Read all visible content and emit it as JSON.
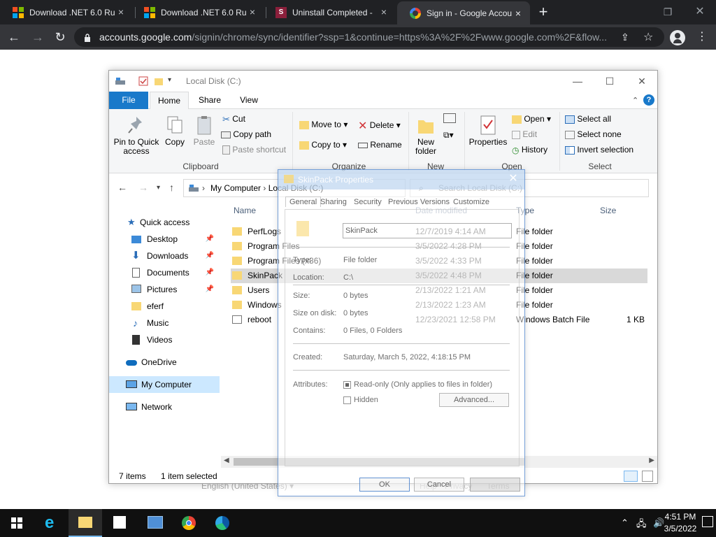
{
  "browser": {
    "tabs": [
      {
        "title": "Download .NET 6.0 Ru",
        "icon": "microsoft-icon"
      },
      {
        "title": "Download .NET 6.0 Ru",
        "icon": "microsoft-icon"
      },
      {
        "title": "Uninstall Completed -",
        "icon": "skinpack-icon"
      },
      {
        "title": "Sign in - Google Accou",
        "icon": "google-icon",
        "active": true
      }
    ],
    "url_host": "accounts.google.com",
    "url_path": "/signin/chrome/sync/identifier?ssp=1&continue=https%3A%2F%2Fwww.google.com%2F&flow..."
  },
  "explorer": {
    "title": "Local Disk (C:)",
    "ribbon_tabs": [
      "File",
      "Home",
      "Share",
      "View"
    ],
    "clipboard": {
      "pin_line1": "Pin to Quick",
      "pin_line2": "access",
      "copy": "Copy",
      "paste": "Paste",
      "cut": "Cut",
      "copy_path": "Copy path",
      "paste_shortcut": "Paste shortcut",
      "label": "Clipboard"
    },
    "organize": {
      "move_to": "Move to",
      "copy_to": "Copy to",
      "delete": "Delete",
      "rename": "Rename",
      "label": "Organize"
    },
    "new": {
      "line1": "New",
      "line2": "folder",
      "label": "New"
    },
    "open": {
      "properties": "Properties",
      "open": "Open",
      "edit": "Edit",
      "history": "History",
      "label": "Open"
    },
    "select": {
      "select_all": "Select all",
      "select_none": "Select none",
      "invert": "Invert selection",
      "label": "Select"
    },
    "address": {
      "root": "My Computer",
      "current": "Local Disk (C:)"
    },
    "search_placeholder": "Search Local Disk (C:)",
    "nav": {
      "quick_access": "Quick access",
      "desktop": "Desktop",
      "downloads": "Downloads",
      "documents": "Documents",
      "pictures": "Pictures",
      "eferf": "eferf",
      "music": "Music",
      "videos": "Videos",
      "onedrive": "OneDrive",
      "my_computer": "My Computer",
      "network": "Network"
    },
    "columns": {
      "name": "Name",
      "date": "Date modified",
      "type": "Type",
      "size": "Size"
    },
    "files": [
      {
        "name": "PerfLogs",
        "date": "12/7/2019 4:14 AM",
        "type": "File folder",
        "size": ""
      },
      {
        "name": "Program Files",
        "date": "3/5/2022 4:28 PM",
        "type": "File folder",
        "size": ""
      },
      {
        "name": "Program Files (x86)",
        "date": "3/5/2022 4:33 PM",
        "type": "File folder",
        "size": ""
      },
      {
        "name": "SkinPack",
        "date": "3/5/2022 4:48 PM",
        "type": "File folder",
        "size": ""
      },
      {
        "name": "Users",
        "date": "2/13/2022 1:21 AM",
        "type": "File folder",
        "size": ""
      },
      {
        "name": "Windows",
        "date": "2/13/2022 1:23 AM",
        "type": "File folder",
        "size": ""
      },
      {
        "name": "reboot",
        "date": "12/23/2021 12:58 PM",
        "type": "Windows Batch File",
        "size": "1 KB"
      }
    ],
    "status_items": "7 items",
    "status_selected": "1 item selected"
  },
  "properties": {
    "title": "SkinPack Properties",
    "tabs": [
      "General",
      "Sharing",
      "Security",
      "Previous Versions",
      "Customize"
    ],
    "name": "SkinPack",
    "type_label": "Type:",
    "type_value": "File folder",
    "location_label": "Location:",
    "location_value": "C:\\",
    "size_label": "Size:",
    "size_value": "0 bytes",
    "size_disk_label": "Size on disk:",
    "size_disk_value": "0 bytes",
    "contains_label": "Contains:",
    "contains_value": "0 Files, 0 Folders",
    "created_label": "Created:",
    "created_value": "Saturday, March 5, 2022, 4:18:15 PM",
    "attributes_label": "Attributes:",
    "readonly": "Read-only (Only applies to files in folder)",
    "hidden": "Hidden",
    "advanced": "Advanced...",
    "ok": "OK",
    "cancel": "Cancel"
  },
  "ghost_page": {
    "language": "English (United States)",
    "help": "Help",
    "privacy": "Privacy",
    "terms": "Terms"
  },
  "taskbar": {
    "time": "4:51 PM",
    "date": "3/5/2022"
  }
}
